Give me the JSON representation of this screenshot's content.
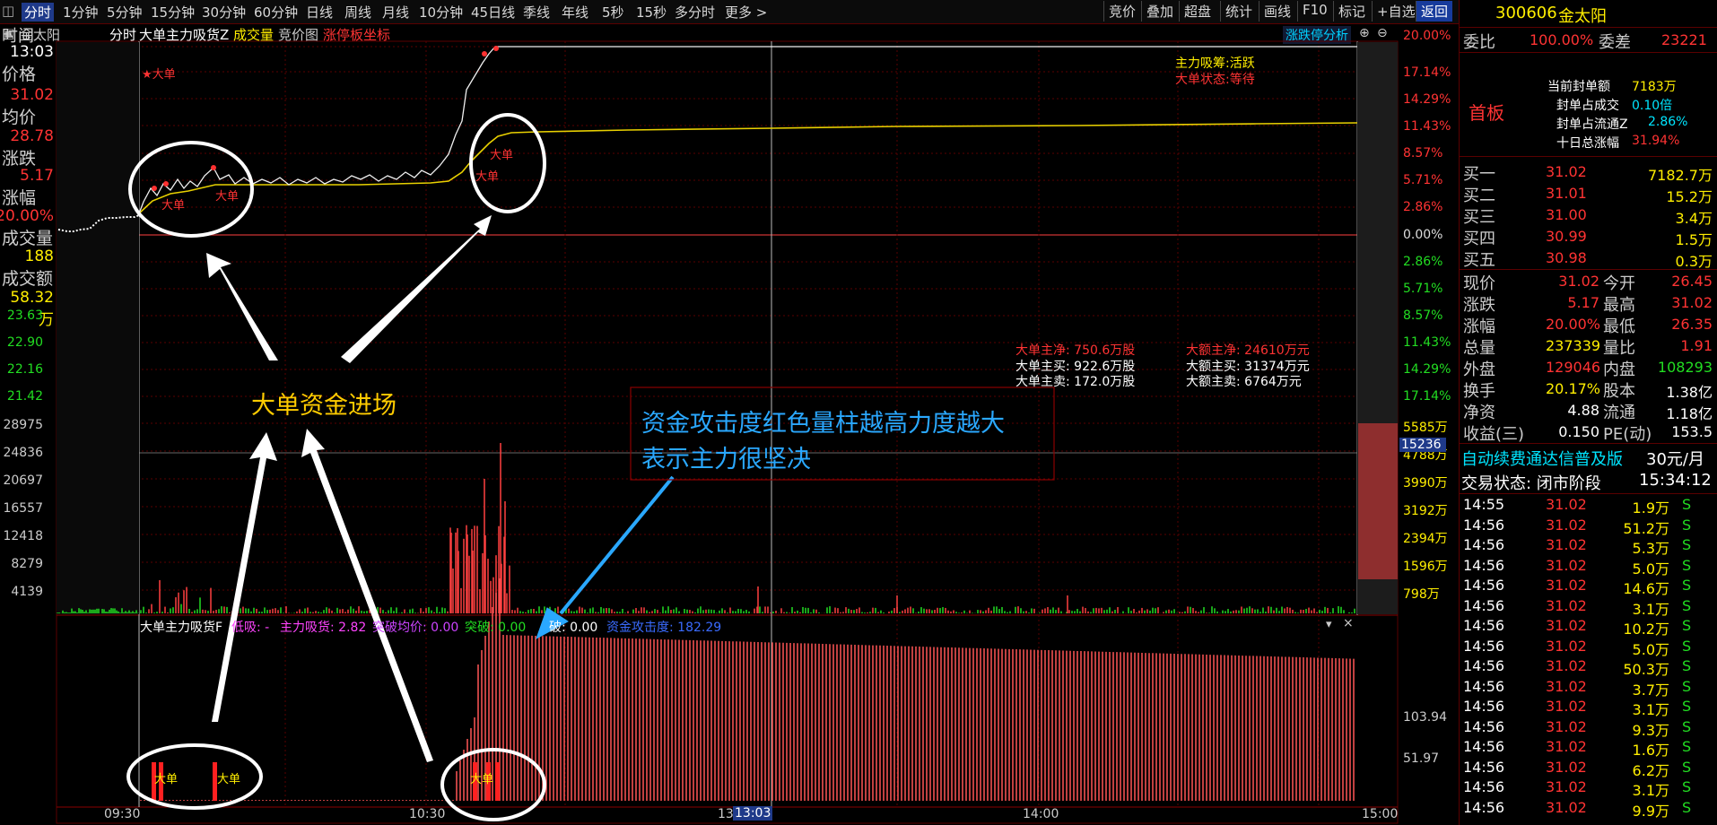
{
  "toolbar": {
    "items": [
      "分时",
      "1分钟",
      "5分钟",
      "15分钟",
      "30分钟",
      "60分钟",
      "日线",
      "周线",
      "月线",
      "10分钟",
      "45日线",
      "季线",
      "年线",
      "5秒",
      "15秒",
      "多分时",
      "更多 >"
    ],
    "right": [
      "竞价",
      "叠加",
      "超盘",
      "统计",
      "画线",
      "F10",
      "标记",
      "+自选",
      "返回"
    ]
  },
  "chart_header": {
    "name": "金太阳",
    "mode": "分时",
    "indicator": "大单主力吸货Z",
    "volume": "成交量",
    "auction": "竞价图",
    "limit_axis": "涨停板坐标",
    "limit_analysis": "涨跌停分析"
  },
  "left_info": {
    "time_label": "时间",
    "time_value": "13:03",
    "price_label": "价格",
    "price_value": "31.02",
    "avg_label": "均价",
    "avg_value": "28.78",
    "change_label": "涨跌",
    "change_value": "5.17",
    "pct_label": "涨幅",
    "pct_value": "20.00%",
    "vol_label": "成交量",
    "vol_value": "188",
    "amount_label": "成交额",
    "amount_value": "58.32万"
  },
  "price_axis": {
    "left": [
      "23.63",
      "22.90",
      "22.16",
      "21.42"
    ],
    "right_pct": [
      "20.00%",
      "17.14%",
      "14.29%",
      "11.43%",
      "8.57%",
      "5.71%",
      "2.86%",
      "0.00%",
      "2.86%",
      "5.71%",
      "8.57%",
      "11.43%",
      "14.29%",
      "17.14%"
    ]
  },
  "vol_axis": {
    "left": [
      "28975",
      "24836",
      "20697",
      "16557",
      "12418",
      "8279",
      "4139"
    ],
    "right": [
      "5585万",
      "4788万",
      "3990万",
      "3192万",
      "2394万",
      "1596万",
      "798万"
    ],
    "cursor": "15236"
  },
  "ind_axis": {
    "right": [
      "103.94",
      "51.97"
    ]
  },
  "time_axis": {
    "labels": [
      "09:30",
      "10:30",
      "13:00",
      "14:00",
      "15:00"
    ],
    "cursor": "13:03"
  },
  "status_box": {
    "line1": "主力吸筹:活跃",
    "line2": "大单状态:等待"
  },
  "stats": {
    "net": "大单主净: 750.6万股",
    "buy": "大单主买: 922.6万股",
    "sell": "大单主卖: 172.0万股",
    "amt_net": "大额主净: 24610万元",
    "amt_buy": "大额主买: 31374万元",
    "amt_sell": "大额主卖: 6764万元"
  },
  "indicator_bar": {
    "name": "大单主力吸货F",
    "lowabsorb": "低吸: -",
    "main": "主力吸货: 2.82",
    "breakavg": "突破均价: 0.00",
    "break": "突破: 0.00",
    "break2": "破: 0.00",
    "attack": "资金攻击度: 182.29"
  },
  "chart_marks": {
    "big": "大单",
    "star_big": "★大单"
  },
  "annotations": {
    "main": "大单资金进场",
    "note_line1": "资金攻击度红色量柱越高力度越大",
    "note_line2": "表示主力很坚决"
  },
  "quote": {
    "code": "300606",
    "name": "金太阳",
    "weibi_label": "委比",
    "weibi": "100.00%",
    "weicha_label": "委差",
    "weicha": "23221",
    "board": "首板",
    "seal_label": "当前封单额",
    "seal": "7183万",
    "seal_ratio_label": "封单占成交",
    "seal_ratio": "0.10倍",
    "seal_float_label": "封单占流通Z",
    "seal_float": "2.86%",
    "ten_day_label": "十日总涨幅",
    "ten_day": "31.94%",
    "bids": [
      {
        "label": "买一",
        "price": "31.02",
        "vol": "7182.7万"
      },
      {
        "label": "买二",
        "price": "31.01",
        "vol": "15.2万"
      },
      {
        "label": "买三",
        "price": "31.00",
        "vol": "3.4万"
      },
      {
        "label": "买四",
        "price": "30.99",
        "vol": "1.5万"
      },
      {
        "label": "买五",
        "price": "30.98",
        "vol": "0.3万"
      }
    ],
    "details": [
      {
        "l1": "现价",
        "v1": "31.02",
        "l2": "今开",
        "v2": "26.45"
      },
      {
        "l1": "涨跌",
        "v1": "5.17",
        "l2": "最高",
        "v2": "31.02"
      },
      {
        "l1": "涨幅",
        "v1": "20.00%",
        "l2": "最低",
        "v2": "26.35"
      },
      {
        "l1": "总量",
        "v1": "237339",
        "l2": "量比",
        "v2": "1.91"
      },
      {
        "l1": "外盘",
        "v1": "129046",
        "l2": "内盘",
        "v2": "108293"
      },
      {
        "l1": "换手",
        "v1": "20.17%",
        "l2": "股本",
        "v2": "1.38亿"
      },
      {
        "l1": "净资",
        "v1": "4.88",
        "l2": "流通",
        "v2": "1.18亿"
      },
      {
        "l1": "收益(三)",
        "v1": "0.150",
        "l2": "PE(动)",
        "v2": "153.5"
      }
    ],
    "ad": "自动续费通达信普及版",
    "price_tag": "30元/月",
    "trade_state": "交易状态: 闭市阶段",
    "trade_time": "15:34:12",
    "trades": [
      {
        "t": "14:55",
        "p": "31.02",
        "v": "1.9万",
        "s": "S"
      },
      {
        "t": "14:56",
        "p": "31.02",
        "v": "51.2万",
        "s": "S"
      },
      {
        "t": "14:56",
        "p": "31.02",
        "v": "5.3万",
        "s": "S"
      },
      {
        "t": "14:56",
        "p": "31.02",
        "v": "5.0万",
        "s": "S"
      },
      {
        "t": "14:56",
        "p": "31.02",
        "v": "14.6万",
        "s": "S"
      },
      {
        "t": "14:56",
        "p": "31.02",
        "v": "3.1万",
        "s": "S"
      },
      {
        "t": "14:56",
        "p": "31.02",
        "v": "10.2万",
        "s": "S"
      },
      {
        "t": "14:56",
        "p": "31.02",
        "v": "5.0万",
        "s": "S"
      },
      {
        "t": "14:56",
        "p": "31.02",
        "v": "50.3万",
        "s": "S"
      },
      {
        "t": "14:56",
        "p": "31.02",
        "v": "3.7万",
        "s": "S"
      },
      {
        "t": "14:56",
        "p": "31.02",
        "v": "3.1万",
        "s": "S"
      },
      {
        "t": "14:56",
        "p": "31.02",
        "v": "9.3万",
        "s": "S"
      },
      {
        "t": "14:56",
        "p": "31.02",
        "v": "1.6万",
        "s": "S"
      },
      {
        "t": "14:56",
        "p": "31.02",
        "v": "6.2万",
        "s": "S"
      },
      {
        "t": "14:56",
        "p": "31.02",
        "v": "3.1万",
        "s": "S"
      },
      {
        "t": "14:56",
        "p": "31.02",
        "v": "9.9万",
        "s": "S"
      }
    ]
  },
  "colors": {
    "up": "#ff3333",
    "down": "#22dd22",
    "price_line": "#ffffff",
    "avg_line": "#e8d000",
    "accent": "#173b9c"
  }
}
